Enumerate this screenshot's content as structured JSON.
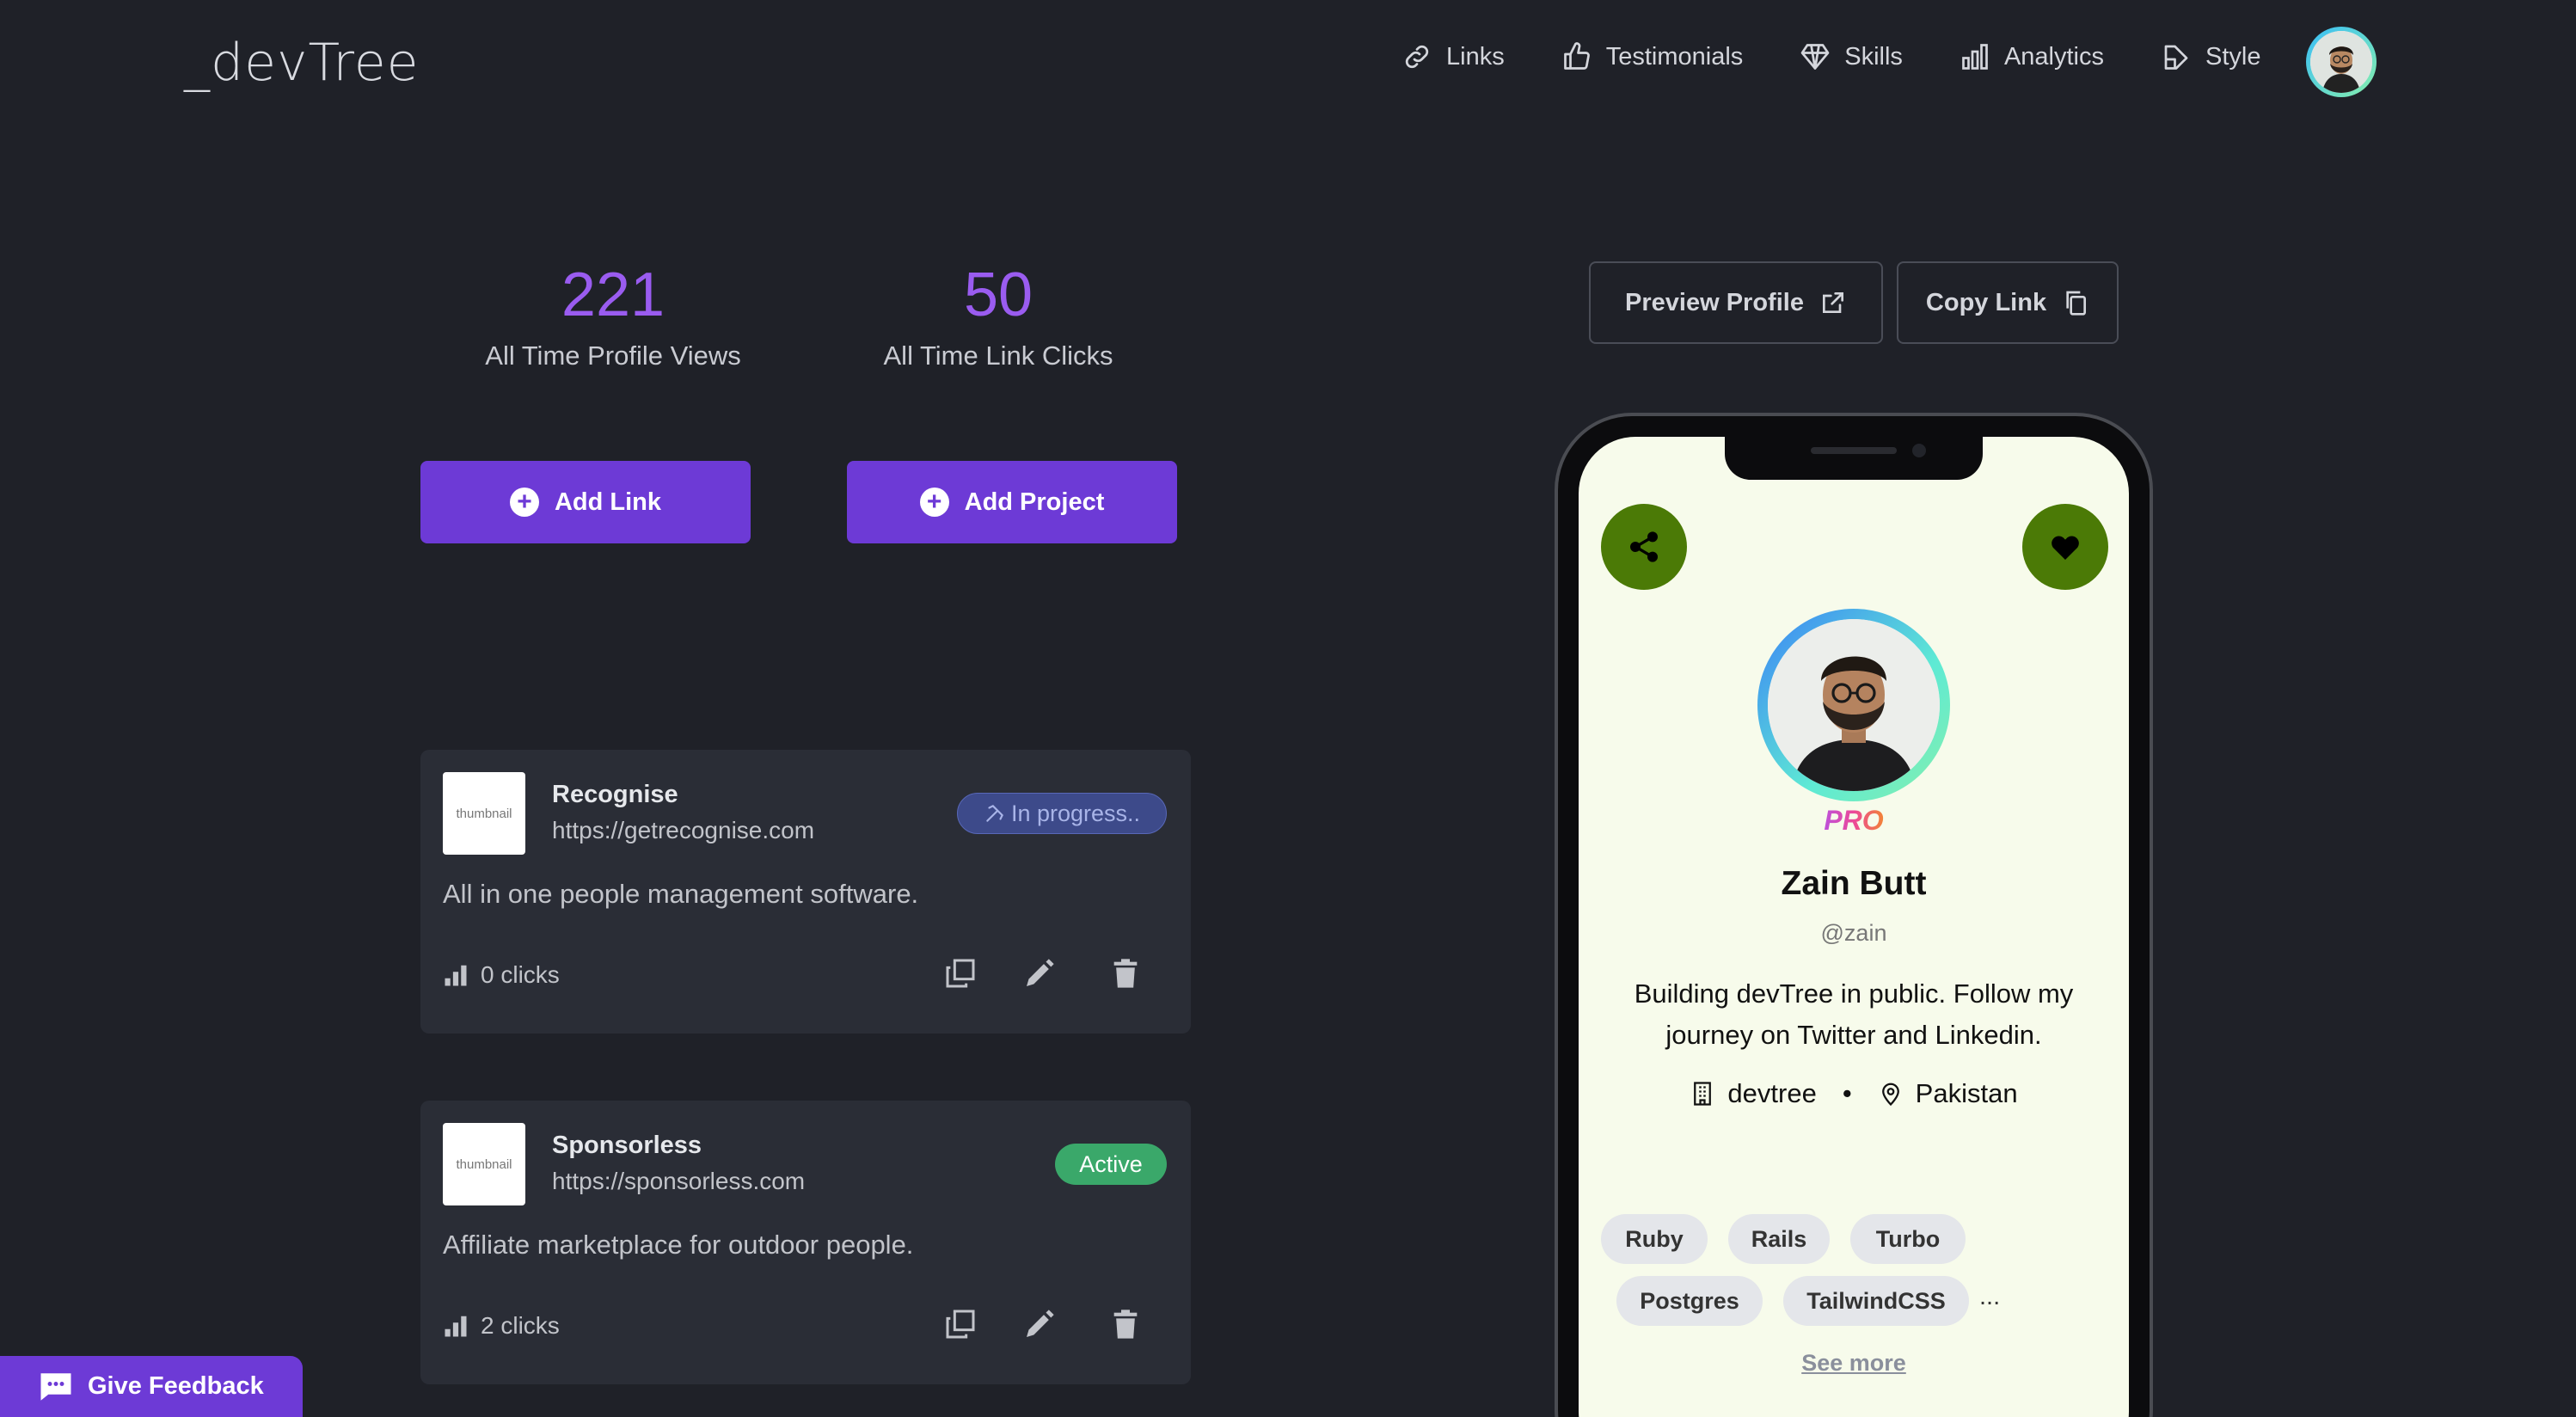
{
  "header": {
    "logo": "_devTree",
    "nav": [
      {
        "label": "Links",
        "icon": "link-icon"
      },
      {
        "label": "Testimonials",
        "icon": "thumbs-up-icon"
      },
      {
        "label": "Skills",
        "icon": "diamond-icon"
      },
      {
        "label": "Analytics",
        "icon": "bar-chart-icon"
      },
      {
        "label": "Style",
        "icon": "brush-icon"
      }
    ]
  },
  "stats": {
    "views": {
      "value": "221",
      "label": "All Time Profile Views"
    },
    "clicks": {
      "value": "50",
      "label": "All Time Link Clicks"
    }
  },
  "actions": {
    "add_link": "Add Link",
    "add_project": "Add Project",
    "preview_profile": "Preview Profile",
    "copy_link": "Copy Link"
  },
  "links": [
    {
      "thumbnail": "thumbnail",
      "title": "Recognise",
      "url": "https://getrecognise.com",
      "description": "All in one people management software.",
      "clicks": "0 clicks",
      "status": "In progress.."
    },
    {
      "thumbnail": "thumbnail",
      "title": "Sponsorless",
      "url": "https://sponsorless.com",
      "description": "Affiliate marketplace for outdoor people.",
      "clicks": "2 clicks",
      "status": "Active"
    }
  ],
  "feedback": "Give Feedback",
  "profile": {
    "badge": "PRO",
    "name": "Zain Butt",
    "handle": "@zain",
    "bio": "Building devTree in public. Follow my journey on Twitter and Linkedin.",
    "company": "devtree",
    "separator": "•",
    "location": "Pakistan",
    "skills": [
      "Ruby",
      "Rails",
      "Turbo",
      "Postgres",
      "TailwindCSS"
    ],
    "more": "...",
    "see_more": "See more"
  },
  "colors": {
    "accent": "#6d3ad6",
    "stat_number": "#9a5cf0",
    "phone_button": "#4b7a06",
    "phone_bg": "#f7fbeb"
  }
}
